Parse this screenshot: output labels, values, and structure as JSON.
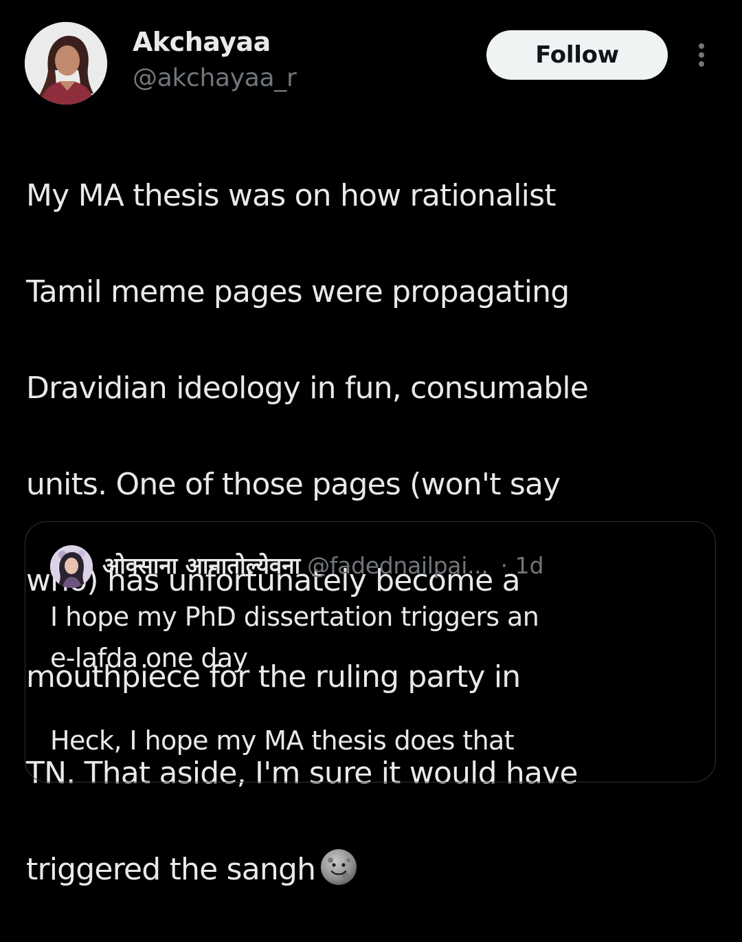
{
  "author": {
    "name": "Akchayaa",
    "handle": "@akchayaa_r"
  },
  "follow_label": "Follow",
  "more_icon": "more-vertical-icon",
  "tweet": {
    "lines": [
      "My MA thesis was on how rationalist",
      "Tamil meme pages were propagating",
      "Dravidian ideology in fun, consumable",
      "units. One of those pages (won't say",
      "who) has unfortunately become a",
      "mouthpiece for the ruling party in",
      "TN. That aside, I'm sure it would have",
      "triggered the sangh"
    ],
    "emoji": "new-moon-face-emoji"
  },
  "quoted": {
    "name": "ओक्साना आनातोल्येवना",
    "handle": "@fadednailpai...",
    "time": "· 1d",
    "lines": [
      "I hope my PhD dissertation triggers an",
      "e-lafda one day",
      "",
      "Heck, I hope my MA thesis does that"
    ]
  },
  "colors": {
    "background": "#000000",
    "text": "#e7e9ea",
    "secondary": "#71767b",
    "border": "#2f3336",
    "follow_bg": "#eff3f4"
  }
}
